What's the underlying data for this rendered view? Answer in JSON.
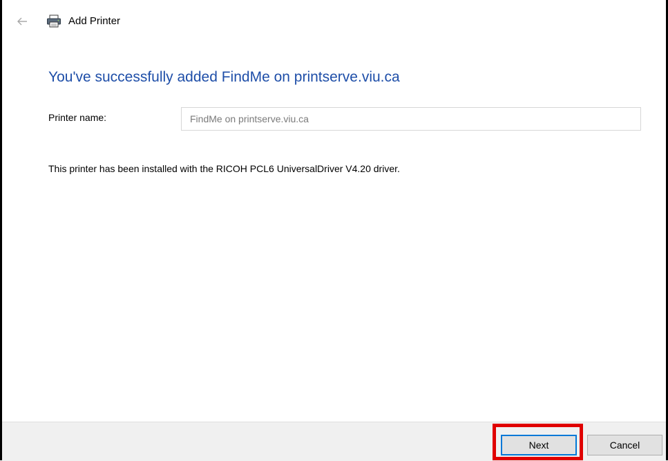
{
  "window": {
    "title": "Add Printer",
    "back_icon": "back-arrow-icon",
    "title_icon": "printer-icon"
  },
  "main": {
    "heading": "You've successfully added FindMe on printserve.viu.ca",
    "printer_name_label": "Printer name:",
    "printer_name_value": "FindMe on printserve.viu.ca",
    "driver_info": "This printer has been installed with the RICOH PCL6 UniversalDriver V4.20 driver."
  },
  "footer": {
    "next_label": "Next",
    "cancel_label": "Cancel"
  },
  "colors": {
    "heading": "#1e4ea8",
    "highlight": "#e00000",
    "focus_border": "#0078d7"
  }
}
